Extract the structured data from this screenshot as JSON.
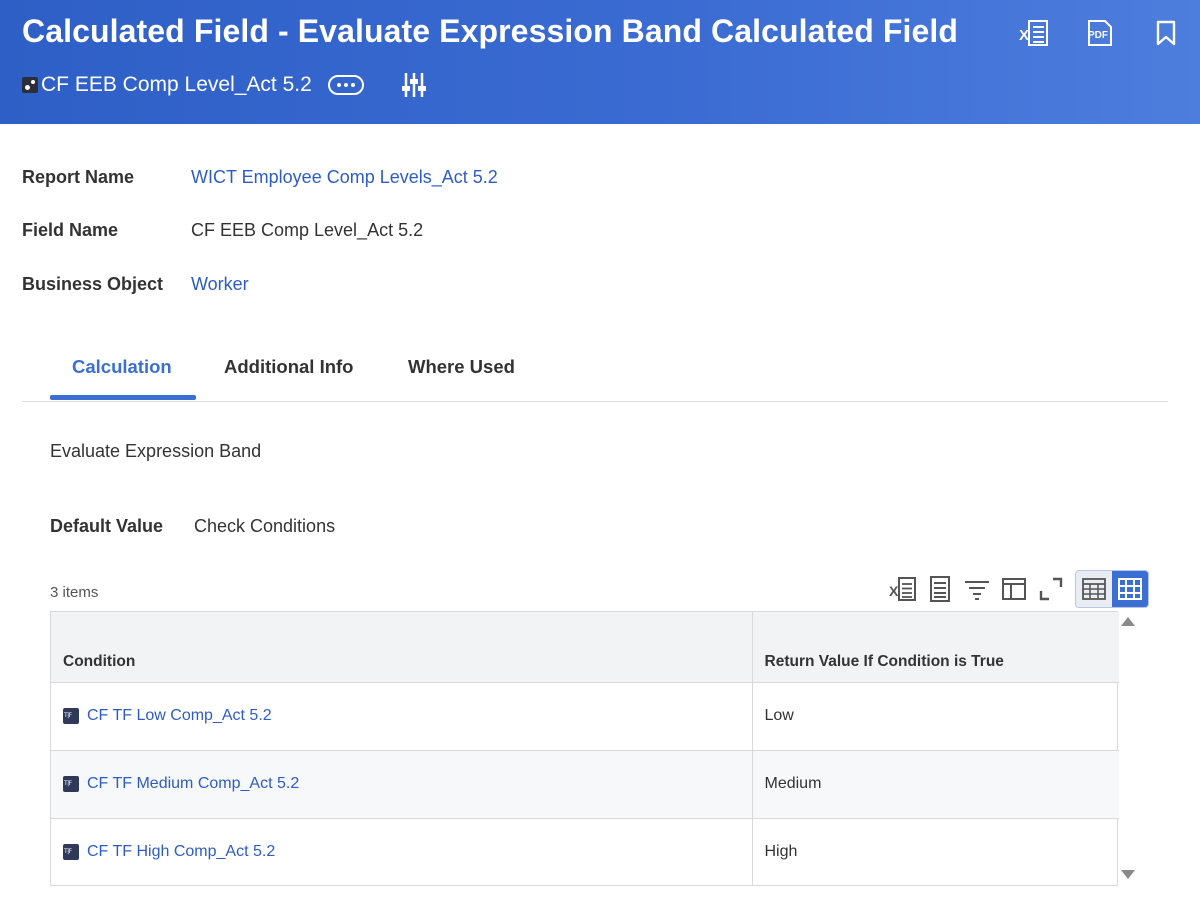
{
  "header": {
    "title": "Calculated Field - Evaluate Expression Band Calculated Field",
    "subtitle": "CF EEB Comp Level_Act 5.2",
    "actions": [
      "excel-export-icon",
      "pdf-export-icon",
      "bookmark-icon"
    ],
    "background_color": "#3a6bd2"
  },
  "fields": {
    "report_name_label": "Report Name",
    "report_name_value": "WICT Employee Comp Levels_Act 5.2",
    "field_name_label": "Field Name",
    "field_name_value": "CF EEB Comp Level_Act 5.2",
    "business_object_label": "Business Object",
    "business_object_value": "Worker"
  },
  "tabs": [
    {
      "label": "Calculation",
      "active": true
    },
    {
      "label": "Additional Info",
      "active": false
    },
    {
      "label": "Where Used",
      "active": false
    }
  ],
  "calculation": {
    "type": "Evaluate Expression Band",
    "default_label": "Default Value",
    "default_value": "Check Conditions"
  },
  "grid": {
    "items_count": "3 items",
    "toolbar": [
      "excel-export-icon",
      "print-icon",
      "filter-icon",
      "column-layout-icon",
      "fullscreen-icon",
      "table-view-icon",
      "grid-view-icon"
    ],
    "columns": [
      "Condition",
      "Return Value If Condition is True"
    ],
    "rows": [
      {
        "condition": "CF TF Low Comp_Act 5.2",
        "return_value": "Low"
      },
      {
        "condition": "CF TF Medium Comp_Act 5.2",
        "return_value": "Medium"
      },
      {
        "condition": "CF TF High Comp_Act 5.2",
        "return_value": "High"
      }
    ]
  },
  "colors": {
    "link": "#2f5cc4",
    "accent": "#3b6fd3"
  }
}
